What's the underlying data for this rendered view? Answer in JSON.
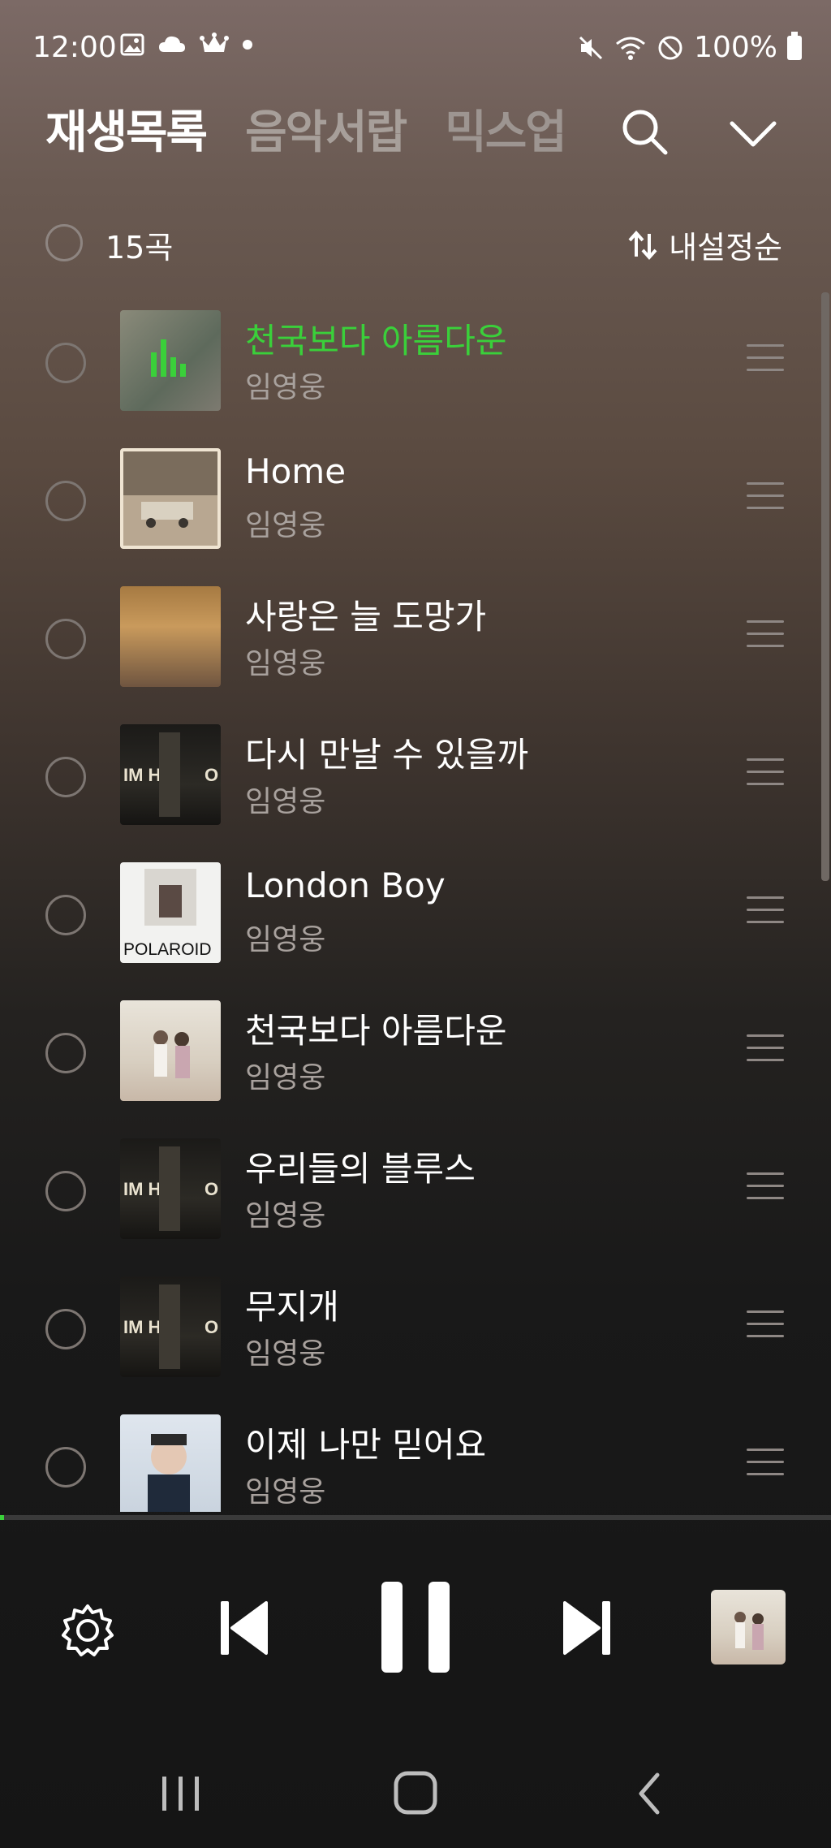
{
  "status": {
    "time": "12:00",
    "battery": "100%",
    "left_icons": [
      "image-icon",
      "cloud-icon",
      "crown-icon",
      "dot-icon"
    ],
    "right_icons": [
      "mute-icon",
      "wifi-icon",
      "do-not-disturb-icon",
      "battery-icon"
    ]
  },
  "tabs": [
    {
      "label": "재생목록"
    },
    {
      "label": "음악서랍"
    },
    {
      "label": "믹스업"
    }
  ],
  "list_header": {
    "count": "15곡",
    "sort_label": "내설정순"
  },
  "songs": [
    {
      "title": "천국보다 아름다운",
      "artist": "임영웅",
      "playing": true
    },
    {
      "title": "Home",
      "artist": "임영웅"
    },
    {
      "title": "사랑은 늘 도망가",
      "artist": "임영웅"
    },
    {
      "title": "다시 만날 수 있을까",
      "artist": "임영웅"
    },
    {
      "title": "London Boy",
      "artist": "임영웅"
    },
    {
      "title": "천국보다 아름다운",
      "artist": "임영웅"
    },
    {
      "title": "우리들의 블루스",
      "artist": "임영웅"
    },
    {
      "title": "무지개",
      "artist": "임영웅"
    },
    {
      "title": "이제 나만 믿어요",
      "artist": "임영웅"
    }
  ],
  "art": {
    "polaroid_text": "POLAROID",
    "hero_text": "IM HE",
    "hero_text2": "O"
  },
  "player": {
    "progress": 0.005
  },
  "colors": {
    "accent_green": "#3ad03a"
  }
}
